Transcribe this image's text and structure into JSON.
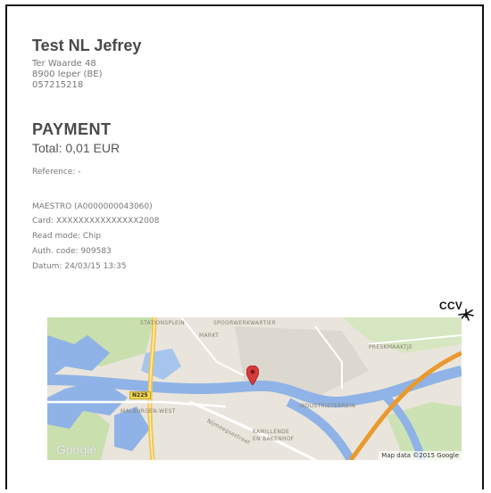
{
  "merchant": {
    "name": "Test NL Jefrey",
    "address_line1": "Ter Waarde 48",
    "address_line2": "8900 Ieper (BE)",
    "phone": "057215218"
  },
  "payment": {
    "title": "PAYMENT",
    "total": "Total: 0,01 EUR",
    "reference": "Reference: -"
  },
  "card": {
    "scheme": "MAESTRO (A0000000043060)",
    "card_number": "Card: XXXXXXXXXXXXXXX2008",
    "read_mode": "Read mode: Chip",
    "auth_code": "Auth. code: 909583",
    "datum": "Datum: 24/03/15 13:35"
  },
  "logo": {
    "text": "CCV"
  },
  "map": {
    "labels": {
      "stationsplein": "STATIONSPLEIN",
      "spoorwerkwartier": "SPOORWERKWARTIER",
      "markt": "MARKT",
      "preskmaaktje": "PRESKMAAKTJE",
      "industrieterrein": "INDUSTRIETERREIN",
      "malburgen": "MALBURGEN-WEST",
      "kamillende": "KAMILLENDE",
      "bakenhof": "EN BAKENHOF",
      "nijmeegsestraat": "Nijmeegsestraat"
    },
    "road_badge": "N225",
    "google": "Google",
    "attribution": "Map data ©2015 Google"
  },
  "colors": {
    "text_dark": "#4a4a4a",
    "text_light": "#777777",
    "water": "#8fb3e6",
    "road_yellow": "#f2c24a",
    "road_orange": "#e99a2e",
    "pin": "#d93a3a"
  }
}
